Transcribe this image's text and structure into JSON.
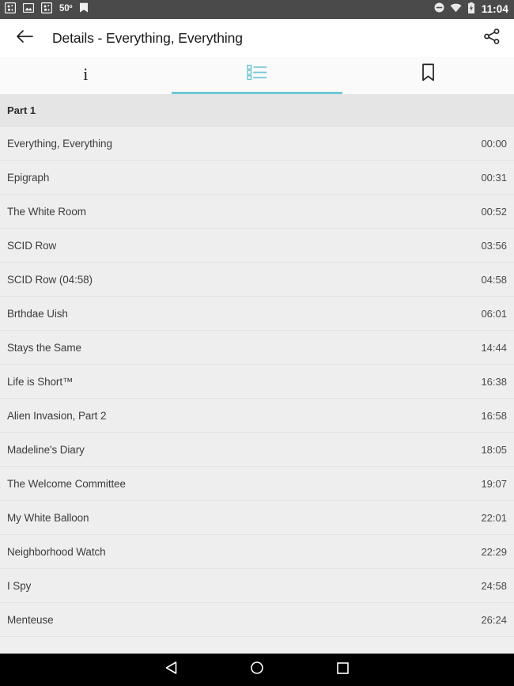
{
  "status_bar": {
    "background_color": "#4a4a4a",
    "left_icons": [
      {
        "name": "weather-notification-icon"
      },
      {
        "name": "screenshot-notification-icon"
      },
      {
        "name": "weather-notification-icon-2"
      }
    ],
    "temperature": "50º",
    "app_notification_icon": "bookmark-notification-icon",
    "right_icons": [
      {
        "name": "do-not-disturb-icon"
      },
      {
        "name": "wifi-icon"
      },
      {
        "name": "battery-charging-icon"
      }
    ],
    "clock": "11:04"
  },
  "app_bar": {
    "back_icon": "back-arrow-icon",
    "title": "Details - Everything, Everything",
    "share_icon": "share-icon",
    "background_color": "#ffffff"
  },
  "tabs": {
    "accent_color": "#72c7d4",
    "selected_index": 1,
    "items": [
      {
        "icon": "info-icon",
        "label": "i",
        "selected": false
      },
      {
        "icon": "chapter-list-icon",
        "label": "",
        "selected": true
      },
      {
        "icon": "bookmark-icon",
        "label": "",
        "selected": false
      }
    ]
  },
  "list": {
    "section_header": "Part 1",
    "chapters": [
      {
        "title": "Everything, Everything",
        "time": "00:00"
      },
      {
        "title": "Epigraph",
        "time": "00:31"
      },
      {
        "title": "The White Room",
        "time": "00:52"
      },
      {
        "title": "SCID Row",
        "time": "03:56"
      },
      {
        "title": "SCID Row (04:58)",
        "time": "04:58"
      },
      {
        "title": "Brthdae Uish",
        "time": "06:01"
      },
      {
        "title": "Stays the Same",
        "time": "14:44"
      },
      {
        "title": "Life is Short™",
        "time": "16:38"
      },
      {
        "title": "Alien Invasion, Part 2",
        "time": "16:58"
      },
      {
        "title": "Madeline's Diary",
        "time": "18:05"
      },
      {
        "title": "The Welcome Committee",
        "time": "19:07"
      },
      {
        "title": "My White Balloon",
        "time": "22:01"
      },
      {
        "title": "Neighborhood Watch",
        "time": "22:29"
      },
      {
        "title": "I Spy",
        "time": "24:58"
      },
      {
        "title": "Menteuse",
        "time": "26:24"
      }
    ]
  },
  "nav_bar": {
    "background_color": "#000000",
    "buttons": [
      {
        "name": "back-nav-button",
        "icon": "triangle-back-icon"
      },
      {
        "name": "home-nav-button",
        "icon": "circle-home-icon"
      },
      {
        "name": "recents-nav-button",
        "icon": "square-recents-icon"
      }
    ]
  }
}
